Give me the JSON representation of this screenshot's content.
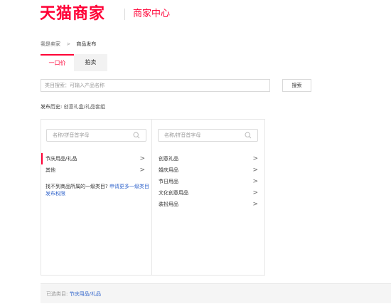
{
  "header": {
    "logo_text": "天猫商家",
    "subtitle": "商家中心"
  },
  "breadcrumb": {
    "root": "我是卖家",
    "separator": ">",
    "current": "商品发布"
  },
  "tabs": [
    {
      "label": "一口价",
      "active": true
    },
    {
      "label": "拍卖",
      "active": false
    }
  ],
  "search": {
    "placeholder": "类目搜索：可输入产品名称",
    "button_label": "搜索"
  },
  "history": {
    "label": "发布历史:",
    "value": "创意礼盒/礼品套组"
  },
  "category_panel": {
    "level1": {
      "search_placeholder": "名称/拼音首字母",
      "items": [
        {
          "label": "节庆用品/礼品",
          "selected": true
        },
        {
          "label": "其他",
          "selected": false
        }
      ],
      "hint_text": "找不到商品所属的一级类目?",
      "hint_link": "申请更多一级类目发布权限"
    },
    "level2": {
      "search_placeholder": "名称/拼音首字母",
      "items": [
        {
          "label": "创意礼品"
        },
        {
          "label": "婚庆用品"
        },
        {
          "label": "节日用品"
        },
        {
          "label": "文化创意用品"
        },
        {
          "label": "装扮用品"
        }
      ]
    },
    "arrow_glyph": ">"
  },
  "footer": {
    "label": "已选类目:",
    "value": "节庆用品/礼品"
  },
  "colors": {
    "brand": "#ff0036",
    "link": "#3366cc"
  }
}
